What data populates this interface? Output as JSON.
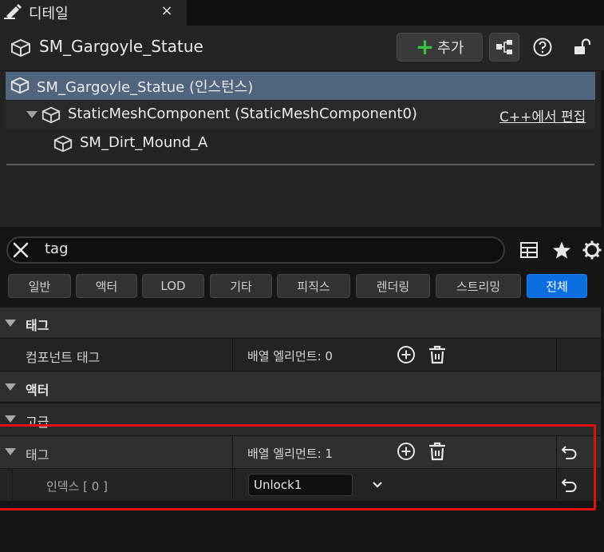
{
  "tab": {
    "title": "디테일",
    "close_glyph": "×"
  },
  "header": {
    "actor_name": "SM_Gargoyle_Statue",
    "add_plus": "+",
    "add_label": "추가"
  },
  "tree": {
    "root": "SM_Gargoyle_Statue (인스턴스)",
    "component": "StaticMeshComponent (StaticMeshComponent0)",
    "edit_cpp": "C++에서 편집",
    "child": "SM_Dirt_Mound_A"
  },
  "search": {
    "value": "tag"
  },
  "filters": [
    "일반",
    "액터",
    "LOD",
    "기타",
    "피직스",
    "렌더링",
    "스트리밍",
    "전체"
  ],
  "details": {
    "cat_tags": "태그",
    "component_tags_label": "컴포넌트 태그",
    "component_tags_value": "배열 엘리먼트: 0",
    "cat_actor": "액터",
    "cat_advanced": "고급",
    "tags_label": "태그",
    "tags_value": "배열 엘리먼트: 1",
    "index_label": "인덱스 [ 0 ]",
    "index_value": "Unlock1"
  },
  "colors": {
    "selection": "#52657e",
    "accent_blue": "#0d6ee0",
    "add_green": "#39c13f",
    "highlight_red": "#e01010"
  }
}
